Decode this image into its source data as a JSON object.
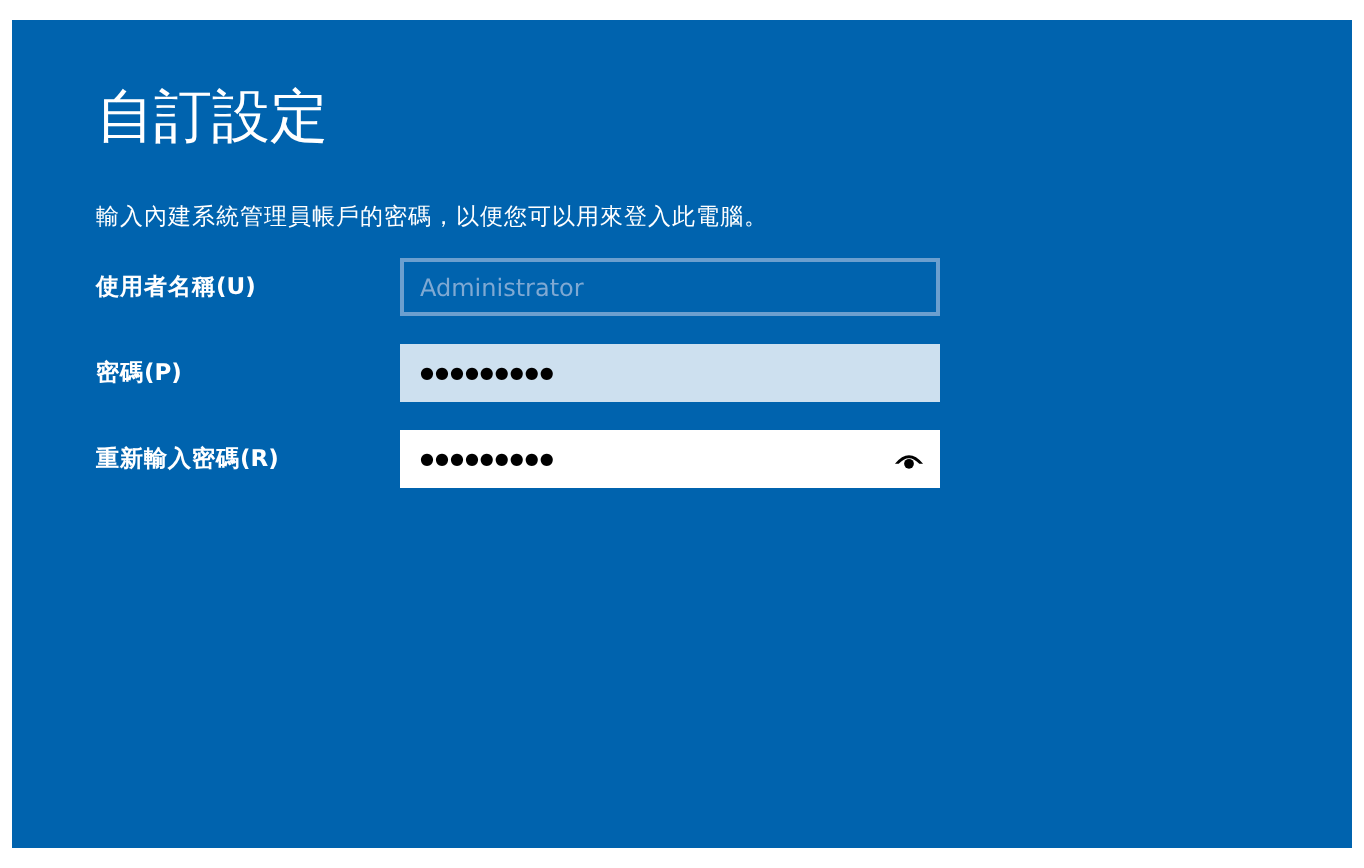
{
  "title": "自訂設定",
  "instruction": "輸入內建系統管理員帳戶的密碼，以便您可以用來登入此電腦。",
  "fields": [
    {
      "label": "使用者名稱(U)",
      "placeholder": "Administrator",
      "disabled": true,
      "focused": false,
      "reveal_button": false
    },
    {
      "label": "密碼(P)",
      "value": "●●●●●●●●●",
      "disabled": false,
      "focused": false,
      "reveal_button": false
    },
    {
      "label": "重新輸入密碼(R)",
      "value": "●●●●●●●●●",
      "disabled": false,
      "focused": true,
      "reveal_button": true
    }
  ]
}
